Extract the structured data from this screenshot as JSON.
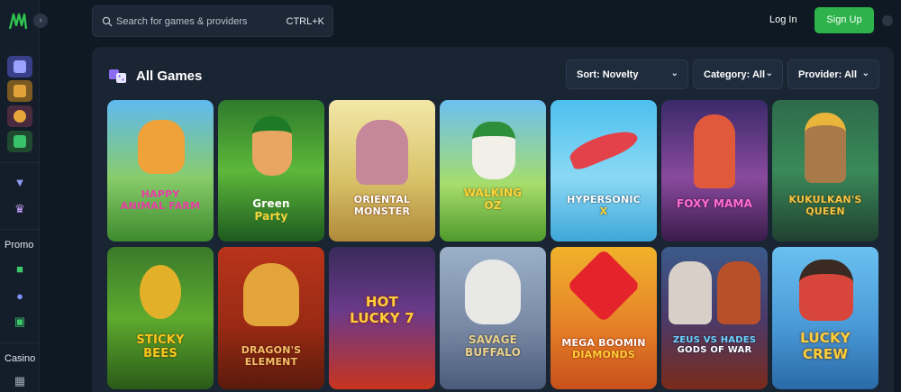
{
  "search": {
    "placeholder": "Search for games & providers",
    "shortcut": "CTRL+K"
  },
  "auth": {
    "login_label": "Log In",
    "signup_label": "Sign Up"
  },
  "sidebar": {
    "collapse_icon": "chevron-right-icon",
    "sections": [
      {
        "label": "Promo"
      },
      {
        "label": "Casino"
      }
    ]
  },
  "panel": {
    "title": "All Games",
    "filters": [
      {
        "label": "Sort: Novelty"
      },
      {
        "label": "Category: All"
      },
      {
        "label": "Provider: All"
      }
    ]
  },
  "games": [
    {
      "line1": "HAPPY",
      "line2": "ANIMAL FARM",
      "accent": "#e83da6"
    },
    {
      "line1": "Green",
      "line2": "Party",
      "accent": "#f3d23a"
    },
    {
      "line1": "ORIENTAL",
      "line2": "MONSTER",
      "accent": "#ffe7b0"
    },
    {
      "line1": "WALKING",
      "line2": "OZ",
      "accent": "#f8d63a"
    },
    {
      "line1": "HYPERSONIC",
      "line2": "X",
      "accent": "#ffd22e"
    },
    {
      "line1": "FOXY MAMA",
      "line2": "",
      "accent": "#ff6fd1"
    },
    {
      "line1": "KUKULKAN'S",
      "line2": "QUEEN",
      "accent": "#f5c445"
    },
    {
      "line1": "STICKY",
      "line2": "BEES",
      "accent": "#f7c81f"
    },
    {
      "line1": "DRAGON'S",
      "line2": "ELEMENT",
      "accent": "#f5c06a"
    },
    {
      "line1": "HOT",
      "line2": "LUCKY 7",
      "accent": "#ffcf3a"
    },
    {
      "line1": "SAVAGE",
      "line2": "BUFFALO",
      "accent": "#e9d28e"
    },
    {
      "line1": "MEGA BOOMIN",
      "line2": "DIAMONDS",
      "accent": "#ffcf3a"
    },
    {
      "line1": "ZEUS VS HADES",
      "line2": "GODS OF WAR",
      "accent": "#6fd4ff"
    },
    {
      "line1": "LUCKY",
      "line2": "CREW",
      "accent": "#ffcf3a"
    }
  ]
}
